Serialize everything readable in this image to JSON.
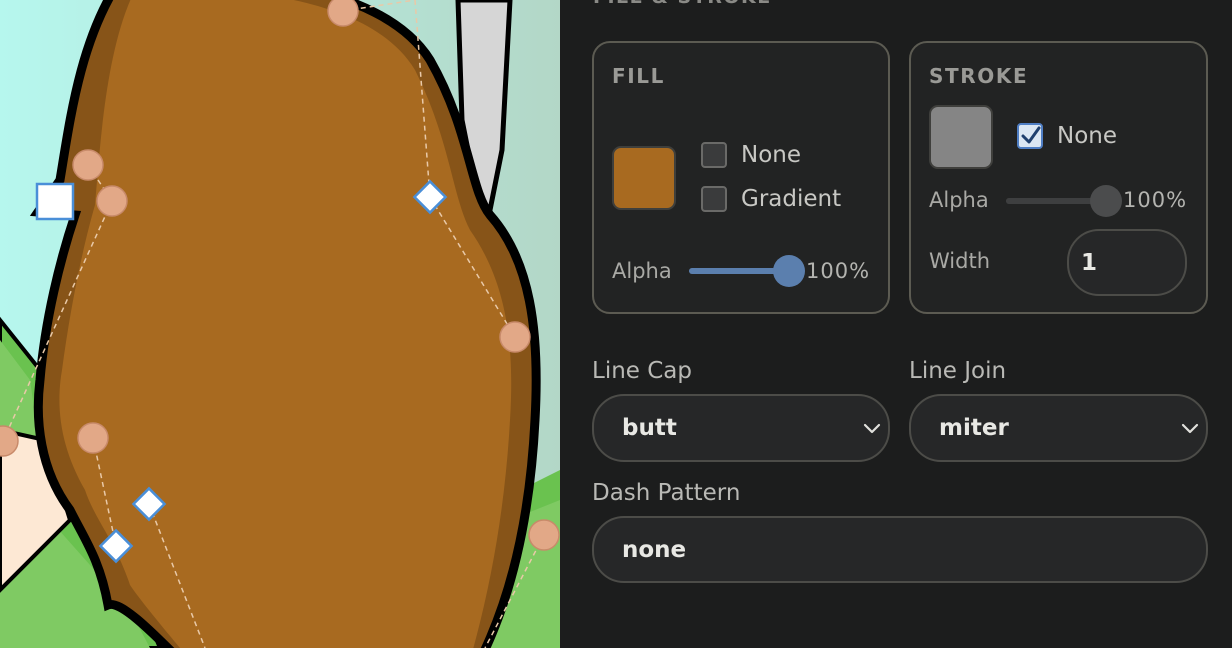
{
  "panel": {
    "section_title": "FILL & STROKE",
    "fill": {
      "heading": "FILL",
      "color": "#a86a20",
      "none_label": "None",
      "none_checked": false,
      "gradient_label": "Gradient",
      "gradient_checked": false,
      "alpha_label": "Alpha",
      "alpha_value": "100%",
      "alpha_fraction": 1.0
    },
    "stroke": {
      "heading": "STROKE",
      "color": "#858585",
      "none_label": "None",
      "none_checked": true,
      "alpha_label": "Alpha",
      "alpha_value": "100%",
      "alpha_fraction": 1.0,
      "width_label": "Width",
      "width_value": "1"
    },
    "line_cap": {
      "label": "Line Cap",
      "value": "butt"
    },
    "line_join": {
      "label": "Line Join",
      "value": "miter"
    },
    "dash_pattern": {
      "label": "Dash Pattern",
      "value": "none"
    }
  },
  "canvas": {
    "shape_fill": "#a86a20",
    "shape_shadow": "#875418",
    "sky_color": "#b3f2e8",
    "grass_color": "#78c862"
  }
}
